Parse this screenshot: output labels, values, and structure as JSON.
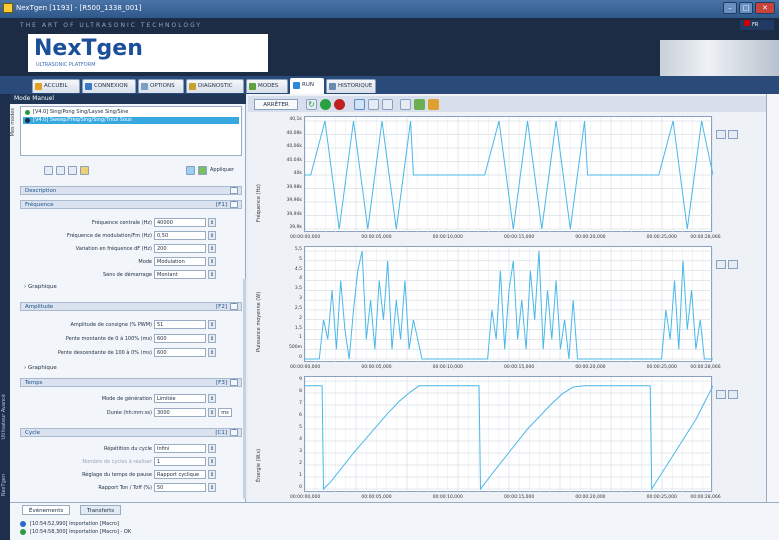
{
  "window": {
    "title": "NexTgen [1193] - [R500_1338_001]"
  },
  "brand": {
    "tagline": "THE ART OF ULTRASONIC TECHNOLOGY",
    "logo": "NexTgen",
    "logo_sub": "ULTRASONIC PLATFORM",
    "flag_text": "FR"
  },
  "tabs": [
    {
      "label": "ACCUEIL",
      "color": "#e0a020"
    },
    {
      "label": "CONNEXION",
      "color": "#3a78c8"
    },
    {
      "label": "OPTIONS",
      "color": "#7aa0c8"
    },
    {
      "label": "DIAGNOSTIC",
      "color": "#c8a030"
    },
    {
      "label": "MODES",
      "color": "#60a040"
    },
    {
      "label": "RUN",
      "color": "#2a8ad8"
    },
    {
      "label": "HISTORIQUE",
      "color": "#6a8ab0"
    }
  ],
  "active_tab": "RUN",
  "left_strip": {
    "top_label": "NexTgen",
    "bottom_label": "Utilisateur Avancé"
  },
  "panel": {
    "title": "Mode Manuel",
    "list_label": "Mes modes",
    "modes": [
      {
        "label": "[V4.0] Sing/Pong Sing/Laysé Sing/Sine",
        "selected": false,
        "dot_color": "#2a9a40"
      },
      {
        "label": "[V4.0] Sweep/Freq/Sing/Sing/Tmul Sous",
        "selected": true,
        "dot_color": "#1c2c44"
      }
    ],
    "apply_label": "Appliquer",
    "sections": {
      "description": {
        "label": "Description"
      },
      "frequence": {
        "label": "Fréquence",
        "hotkey": "[F1]"
      },
      "amplitude": {
        "label": "Amplitude",
        "hotkey": "[F2]"
      },
      "temps": {
        "label": "Temps",
        "hotkey": "[F3]"
      },
      "cycle": {
        "label": "Cycle",
        "hotkey": "[C1]"
      }
    },
    "freq_rows": [
      {
        "label": "Fréquence centrale (Hz)",
        "value": "40000"
      },
      {
        "label": "Fréquence de modulation/Fm (Hz)",
        "value": "0,50"
      },
      {
        "label": "Variation en fréquence dF (Hz)",
        "value": "200"
      },
      {
        "label": "Mode",
        "value": "Modulation"
      },
      {
        "label": "Sens de démarrage",
        "value": "Montant"
      }
    ],
    "graph_label": "Graphique",
    "amp_rows": [
      {
        "label": "Amplitude de consigne (% PWM)",
        "value": "51"
      },
      {
        "label": "Pente montante de 0 à 100% (ms)",
        "value": "600"
      },
      {
        "label": "Pente descendante de 100 à 0% (ms)",
        "value": "600"
      }
    ],
    "time_rows": [
      {
        "label": "Mode de génération",
        "value": "Limitée"
      },
      {
        "label": "Durée (hh:mm:ss)",
        "value": "3000",
        "unit": "ms"
      }
    ],
    "cycle_rows": [
      {
        "label": "Répétition du cycle",
        "value": "Infini",
        "dim": false
      },
      {
        "label": "Nombre de cycles à réaliser",
        "value": "1",
        "dim": true
      },
      {
        "label": "Réglage du temps de pause",
        "value": "Rapport cyclique",
        "dim": false
      },
      {
        "label": "Rapport Ton / Toff (%)",
        "value": "50",
        "dim": false
      }
    ]
  },
  "chart_toolbar": {
    "stop_label": "ARRÊTER"
  },
  "x_ticks": [
    "00:00:00,000",
    "00:00:05,000",
    "00:00:10,000",
    "00:00:15,000",
    "00:00:20,000",
    "00:00:25,000",
    "00:00:28,066"
  ],
  "chart_data": [
    {
      "type": "line",
      "ylabel": "Fréquence (Hz)",
      "y_ticks": [
        "40,1k",
        "40,08k",
        "40,06k",
        "40,04k",
        "40k",
        "39,98k",
        "39,96k",
        "39,94k",
        "39,9k"
      ],
      "ylim": [
        39900,
        40100
      ],
      "series": [
        {
          "color": "#4ab8e8",
          "x": [
            0,
            0.4,
            1.4,
            2.4,
            3.4,
            4.4,
            5.4,
            6.4,
            7.4,
            7.6,
            12.4,
            12.6,
            13.6,
            14.6,
            15.6,
            16.6,
            17.6,
            18.6,
            19.6,
            19.8,
            24.6,
            24.8,
            25.8,
            26.8,
            27.8,
            28.6
          ],
          "y": [
            40000,
            40000,
            40100,
            39900,
            40100,
            39900,
            40100,
            39900,
            40100,
            40000,
            40000,
            40000,
            40100,
            39900,
            40100,
            39900,
            40100,
            39900,
            40100,
            40000,
            40000,
            40000,
            40100,
            39900,
            40100,
            40000
          ]
        }
      ]
    },
    {
      "type": "line",
      "ylabel": "Puissance moyenne (W)",
      "y_ticks": [
        "5,5",
        "5",
        "4,5",
        "4",
        "3,5",
        "3",
        "2,5",
        "2",
        "1,5",
        "1",
        "500m",
        "0"
      ],
      "ylim": [
        0,
        5.5
      ],
      "series": [
        {
          "color": "#4ab8e8",
          "x": [
            0,
            1.0,
            1.3,
            1.6,
            1.9,
            2.2,
            2.5,
            2.8,
            3.1,
            3.4,
            3.7,
            4.0,
            4.3,
            4.6,
            4.9,
            5.2,
            5.5,
            5.8,
            6.1,
            6.4,
            6.7,
            7.0,
            7.3,
            7.6,
            8.2,
            12.8,
            13.1,
            13.4,
            13.7,
            14.0,
            14.3,
            14.6,
            14.9,
            15.2,
            15.5,
            15.8,
            16.1,
            16.4,
            16.7,
            17.0,
            17.3,
            17.6,
            17.9,
            18.2,
            18.5,
            18.8,
            19.1,
            20.6,
            25.0,
            25.3,
            25.6,
            25.9,
            26.2,
            26.5,
            26.8,
            27.1,
            27.4,
            27.7,
            28.0,
            28.6
          ],
          "y": [
            0,
            0,
            2,
            1,
            3.5,
            0.5,
            4,
            1.5,
            0,
            2.5,
            4.5,
            5.5,
            1,
            3,
            0.5,
            4,
            2,
            5,
            0.5,
            3,
            1,
            4,
            0.5,
            2,
            0,
            0,
            2.5,
            1,
            4.5,
            0.5,
            3.5,
            5,
            1,
            3,
            0.5,
            4.5,
            2,
            5.5,
            0.5,
            3.5,
            1,
            4,
            0.5,
            2,
            0,
            3,
            0,
            0,
            0,
            2.5,
            1,
            4,
            0.5,
            5,
            1.5,
            3.5,
            0.5,
            2,
            0,
            0
          ]
        }
      ]
    },
    {
      "type": "line",
      "ylabel": "Énergie (W.s)",
      "y_ticks": [
        "9",
        "8",
        "7",
        "6",
        "5",
        "4",
        "3",
        "2",
        "1",
        "0"
      ],
      "ylim": [
        0,
        9
      ],
      "series": [
        {
          "color": "#4ab8e8",
          "x": [
            0,
            1.2,
            1.3,
            1.8,
            2.6,
            3.4,
            4.2,
            5.0,
            5.8,
            6.6,
            7.4,
            8.0,
            12.2,
            12.3,
            13.2,
            14.0,
            14.8,
            15.6,
            16.4,
            17.2,
            18.0,
            18.8,
            19.6,
            20.2,
            24.2,
            24.3,
            25.0,
            25.8,
            26.6,
            27.4,
            28.0,
            28.6
          ],
          "y": [
            8.6,
            8.6,
            0,
            0.6,
            1.8,
            3.0,
            4.1,
            5.2,
            6.3,
            7.3,
            8.1,
            8.6,
            8.6,
            0,
            1.4,
            2.6,
            3.8,
            5.0,
            6.0,
            7.0,
            7.9,
            8.5,
            8.6,
            8.6,
            8.6,
            0,
            1.3,
            2.8,
            4.3,
            5.8,
            7.2,
            8.6
          ]
        }
      ]
    }
  ],
  "bottom": {
    "tabs": [
      "Événements",
      "Transferts"
    ],
    "events": [
      {
        "text": "[10:54:52,990] Importation [Macro]",
        "color": "#2a6ac8"
      },
      {
        "text": "[10:54:58,300] Importation [Macro] - OK",
        "color": "#2a9a40"
      }
    ]
  }
}
